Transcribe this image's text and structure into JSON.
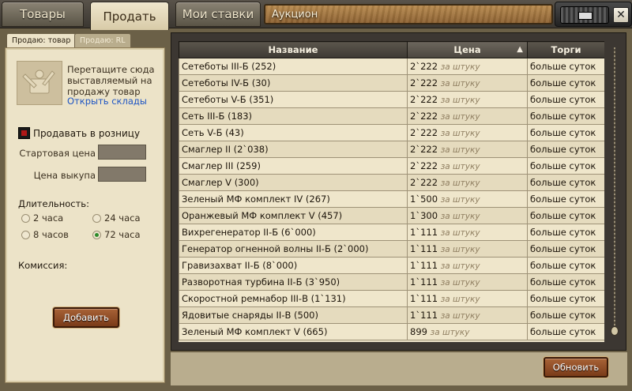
{
  "tabs": [
    {
      "label": "Товары",
      "active": false
    },
    {
      "label": "Продать",
      "active": true
    },
    {
      "label": "Мои ставки",
      "active": false
    }
  ],
  "window_title": "Аукцион",
  "close_glyph": "✕",
  "left": {
    "subtabs": [
      {
        "label": "Продаю: товар",
        "active": true
      },
      {
        "label": "Продаю: RL",
        "active": false
      }
    ],
    "drop_text": "Перетащите сюда выставляемый на продажу товар",
    "open_warehouses": "Открыть склады",
    "retail_label": "Продавать в розницу",
    "retail_checked": true,
    "start_price_label": "Стартовая цена",
    "start_price_value": "",
    "buyout_label": "Цена выкупа",
    "buyout_value": "",
    "duration_label": "Длительность:",
    "durations": [
      {
        "label": "2 часа",
        "selected": false
      },
      {
        "label": "24 часа",
        "selected": false
      },
      {
        "label": "8 часов",
        "selected": false
      },
      {
        "label": "72 часа",
        "selected": true
      }
    ],
    "commission_label": "Комиссия:",
    "add_button": "Добавить"
  },
  "table": {
    "columns": [
      "Название",
      "Цена",
      "Торги"
    ],
    "sorted_column": "Цена",
    "sort_direction": "ascending",
    "per_unit": "за штуку",
    "rows": [
      {
        "name": "Сетеботы III-Б (252)",
        "price": "2`222",
        "per_unit": true,
        "bids": "больше суток"
      },
      {
        "name": "Сетеботы IV-Б (30)",
        "price": "2`222",
        "per_unit": true,
        "bids": "больше суток"
      },
      {
        "name": "Сетеботы V-Б (351)",
        "price": "2`222",
        "per_unit": true,
        "bids": "больше суток"
      },
      {
        "name": "Сеть III-Б (183)",
        "price": "2`222",
        "per_unit": true,
        "bids": "больше суток"
      },
      {
        "name": "Сеть V-Б (43)",
        "price": "2`222",
        "per_unit": true,
        "bids": "больше суток"
      },
      {
        "name": "Смаглер II (2`038)",
        "price": "2`222",
        "per_unit": true,
        "bids": "больше суток"
      },
      {
        "name": "Смаглер III (259)",
        "price": "2`222",
        "per_unit": true,
        "bids": "больше суток"
      },
      {
        "name": "Смаглер V (300)",
        "price": "2`222",
        "per_unit": true,
        "bids": "больше суток"
      },
      {
        "name": "Зеленый МФ комплект IV (267)",
        "price": "1`500",
        "per_unit": true,
        "bids": "больше суток"
      },
      {
        "name": "Оранжевый МФ комплект V (457)",
        "price": "1`300",
        "per_unit": true,
        "bids": "больше суток"
      },
      {
        "name": "Вихрегенератор II-Б (6`000)",
        "price": "1`111",
        "per_unit": true,
        "bids": "больше суток"
      },
      {
        "name": "Генератор огненной волны II-Б (2`000)",
        "price": "1`111",
        "per_unit": true,
        "bids": "больше суток"
      },
      {
        "name": "Гравизахват II-Б (8`000)",
        "price": "1`111",
        "per_unit": true,
        "bids": "больше суток"
      },
      {
        "name": "Разворотная турбина II-Б (3`950)",
        "price": "1`111",
        "per_unit": true,
        "bids": "больше суток"
      },
      {
        "name": "Скоростной ремнабор III-В (1`131)",
        "price": "1`111",
        "per_unit": true,
        "bids": "больше суток"
      },
      {
        "name": "Ядовитые снаряды II-В (500)",
        "price": "1`111",
        "per_unit": true,
        "bids": "больше суток"
      },
      {
        "name": "Зеленый МФ комплект V (665)",
        "price": "899",
        "per_unit": true,
        "bids": "больше суток"
      }
    ]
  },
  "refresh_button": "Обновить"
}
